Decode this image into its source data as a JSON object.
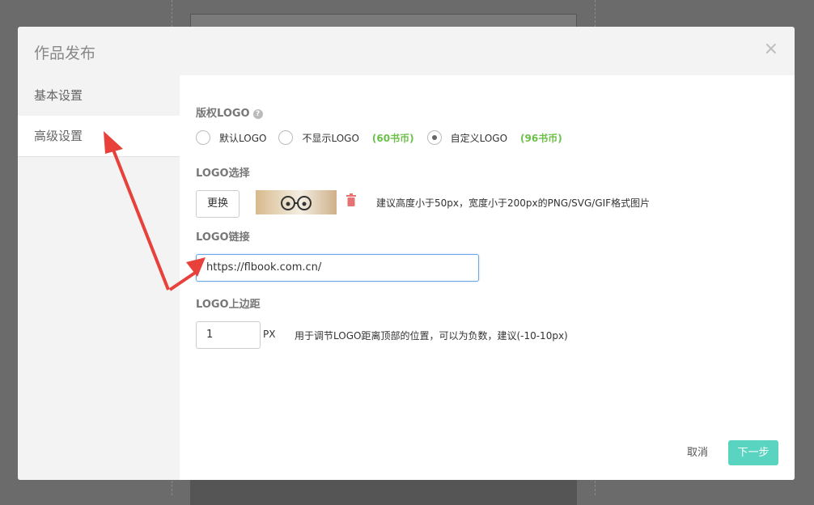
{
  "dialog": {
    "title": "作品发布",
    "close_glyph": "×"
  },
  "sidebar": {
    "items": [
      {
        "label": "基本设置",
        "active": false
      },
      {
        "label": "高级设置",
        "active": true
      }
    ]
  },
  "copyright_logo": {
    "label": "版权LOGO",
    "help_glyph": "?",
    "options": [
      {
        "label": "默认LOGO",
        "price": "",
        "checked": false
      },
      {
        "label": "不显示LOGO",
        "price": "(60书币)",
        "checked": false
      },
      {
        "label": "自定义LOGO",
        "price": "(96书币)",
        "checked": true
      }
    ]
  },
  "logo_select": {
    "label": "LOGO选择",
    "change_button": "更换",
    "image_icon": "logo-thumbnail",
    "delete_icon": "trash-icon",
    "hint": "建议高度小于50px，宽度小于200px的PNG/SVG/GIF格式图片"
  },
  "logo_link": {
    "label": "LOGO链接",
    "value": "https://flbook.com.cn/"
  },
  "logo_margin": {
    "label": "LOGO上边距",
    "value": "1",
    "unit": "PX",
    "hint": "用于调节LOGO距离顶部的位置，可以为负数，建议(-10-10px)"
  },
  "footer": {
    "cancel": "取消",
    "next": "下一步"
  },
  "colors": {
    "accent": "#59d4c0",
    "price": "#6cc04a",
    "annotation_arrow": "#e8403a"
  }
}
